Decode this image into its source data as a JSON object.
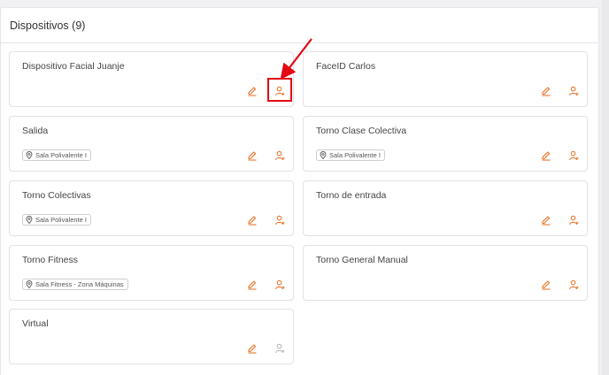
{
  "panel": {
    "title": "Dispositivos (9)"
  },
  "colors": {
    "accent": "#e8762d",
    "disabled": "#b8b8bc",
    "highlight": "#e30613"
  },
  "icons": {
    "edit": "pencil-icon",
    "user": "user-icon",
    "location": "location-pin-icon"
  },
  "devices": [
    {
      "name": "Dispositivo Facial Juanje",
      "location": "",
      "user_enabled": true,
      "highlighted": true
    },
    {
      "name": "FaceID Carlos",
      "location": "",
      "user_enabled": true
    },
    {
      "name": "Salida",
      "location": "Sala Polivalente I",
      "user_enabled": true
    },
    {
      "name": "Torno Clase Colectiva",
      "location": "Sala Polivalente I",
      "user_enabled": true
    },
    {
      "name": "Torno Colectivas",
      "location": "Sala Polivalente I",
      "user_enabled": true
    },
    {
      "name": "Torno de entrada",
      "location": "",
      "user_enabled": true
    },
    {
      "name": "Torno Fitness",
      "location": "Sala Fitness - Zona Máquinas",
      "user_enabled": true
    },
    {
      "name": "Torno General Manual",
      "location": "",
      "user_enabled": true
    },
    {
      "name": "Virtual",
      "location": "",
      "user_enabled": false
    }
  ]
}
